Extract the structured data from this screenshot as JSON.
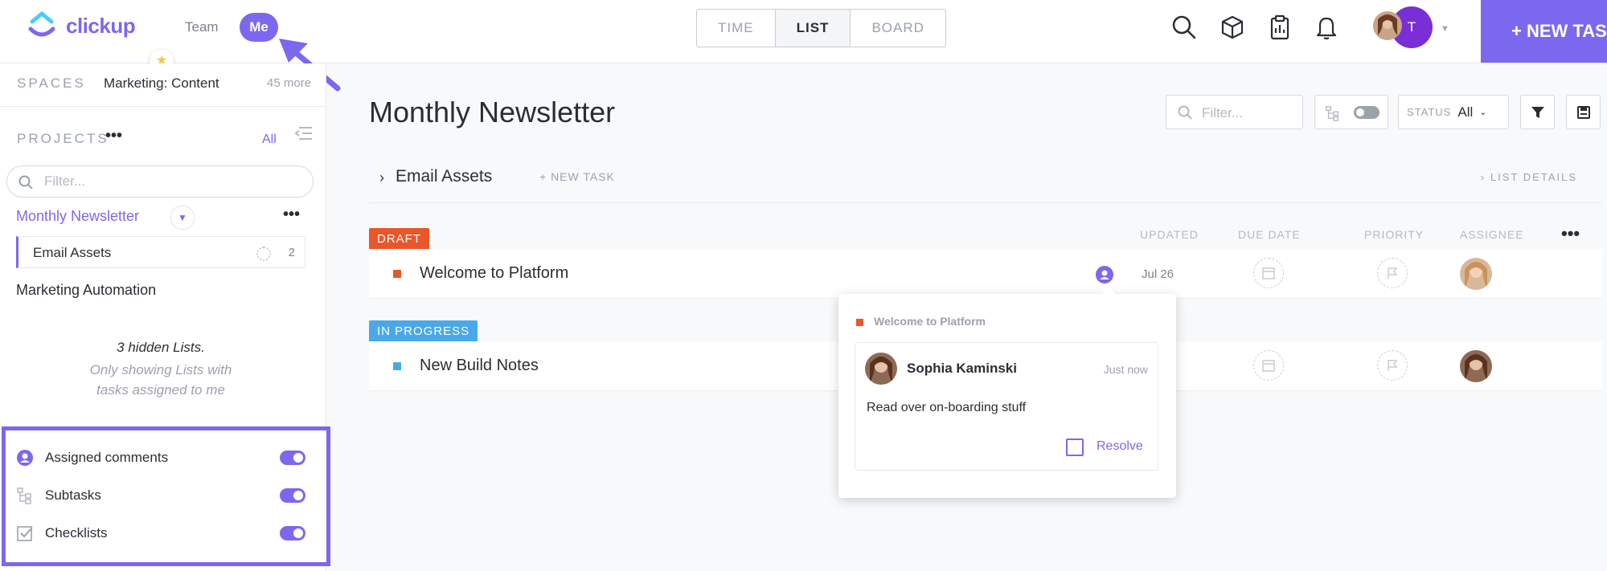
{
  "app": {
    "logo_text": "clickup"
  },
  "topnav": {
    "team_label": "Team",
    "me_label": "Me"
  },
  "views": {
    "tabs": [
      "TIME",
      "LIST",
      "BOARD"
    ],
    "active": "LIST"
  },
  "user": {
    "avatar_initial": "T"
  },
  "new_task_label": "+ NEW TAS",
  "sidebar": {
    "spaces_label": "SPACES",
    "space_name": "Marketing: Content",
    "more_label": "45 more",
    "projects_label": "PROJECTS",
    "projects_dots": "•••",
    "all_label": "All",
    "filter_placeholder": "Filter...",
    "active_list": "Monthly Newsletter",
    "list_dots": "•••",
    "sublist": {
      "label": "Email Assets",
      "count": "2"
    },
    "other_list": "Marketing Automation",
    "hidden_title": "3 hidden Lists.",
    "hidden_desc_1": "Only showing Lists with",
    "hidden_desc_2": "tasks assigned to me",
    "options": [
      {
        "label": "Assigned comments",
        "icon": "person-circle-icon",
        "enabled": true
      },
      {
        "label": "Subtasks",
        "icon": "subtasks-icon",
        "enabled": true
      },
      {
        "label": "Checklists",
        "icon": "checkbox-icon",
        "enabled": true
      }
    ]
  },
  "main": {
    "title": "Monthly Newsletter",
    "filter_placeholder": "Filter...",
    "status_key": "STATUS",
    "status_value": "All",
    "group_name": "Email Assets",
    "group_new_task": "+ NEW TASK",
    "list_details": "LIST DETAILS",
    "columns": {
      "updated": "UPDATED",
      "due_date": "DUE DATE",
      "priority": "PRIORITY",
      "assignee": "ASSIGNEE"
    },
    "column_dots": "•••",
    "groups": [
      {
        "status": "DRAFT",
        "color": "#e8562a",
        "task": "Welcome to Platform",
        "updated": "Jul 26"
      },
      {
        "status": "IN PROGRESS",
        "color": "#4aa8e8",
        "task": "New Build Notes",
        "updated": ""
      }
    ]
  },
  "comment_popup": {
    "task": "Welcome to Platform",
    "user": "Sophia Kaminski",
    "time": "Just now",
    "message": "Read over on-boarding stuff",
    "resolve_label": "Resolve"
  },
  "colors": {
    "accent": "#7b68ee",
    "draft": "#e8562a",
    "in_progress": "#4aa8e8"
  }
}
